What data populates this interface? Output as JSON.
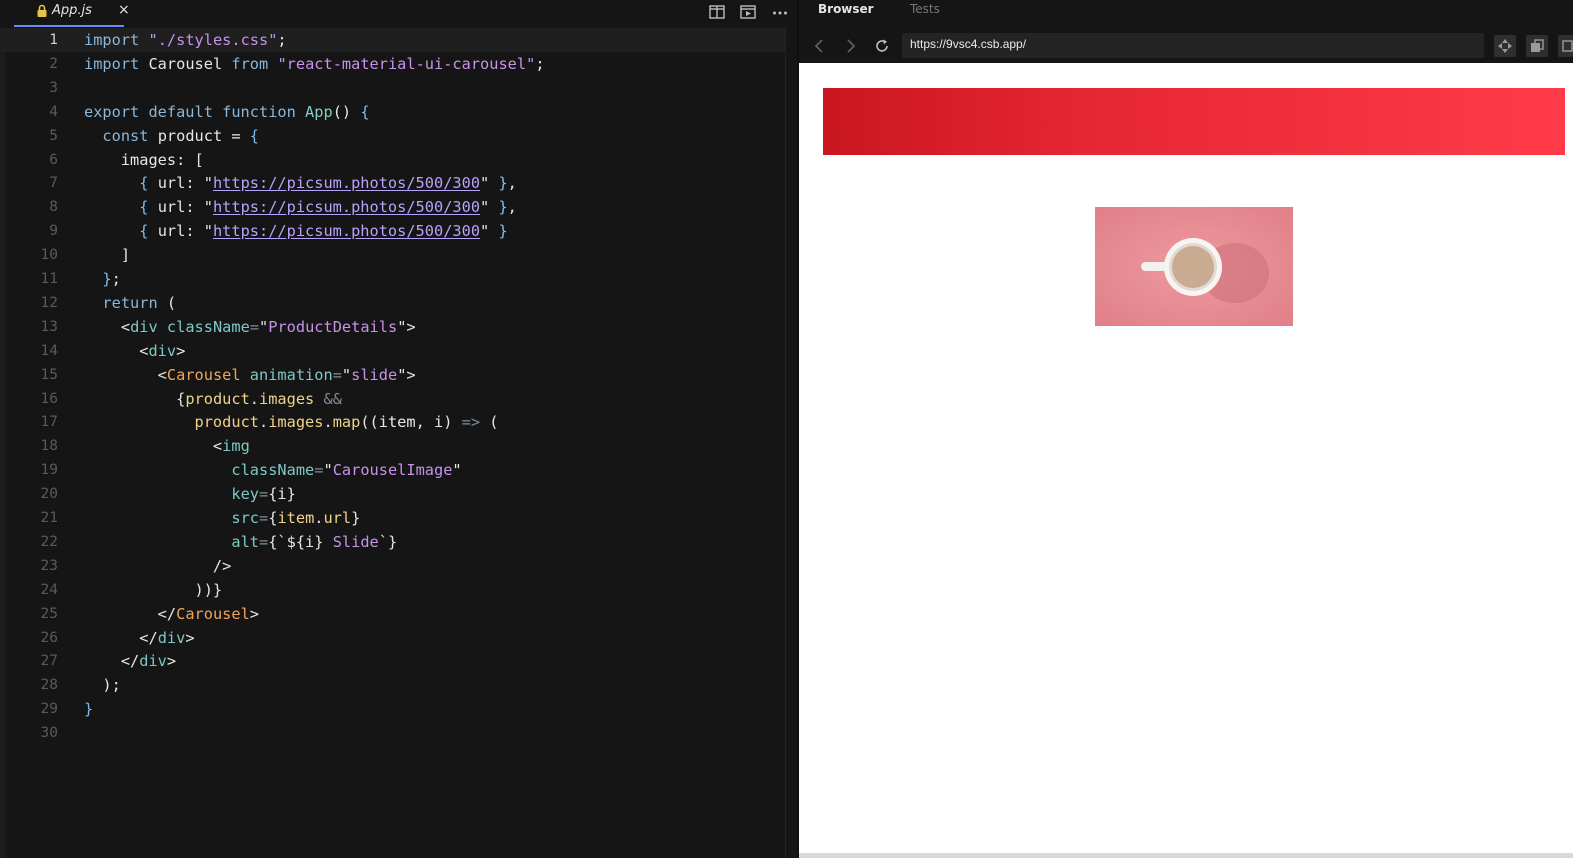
{
  "editor": {
    "tab": {
      "title": "App.js",
      "close": "×"
    },
    "toolbar_icons": [
      "split-editor-icon",
      "preview-icon",
      "more-icon"
    ],
    "lines": [
      {
        "n": "1",
        "tokens": [
          [
            "kw",
            "import"
          ],
          [
            "ident",
            " "
          ],
          [
            "str",
            "\"./styles.css\""
          ],
          [
            "ident",
            ";"
          ]
        ]
      },
      {
        "n": "2",
        "tokens": [
          [
            "kw",
            "import"
          ],
          [
            "ident",
            " Carousel "
          ],
          [
            "kw",
            "from"
          ],
          [
            "ident",
            " "
          ],
          [
            "str",
            "\"react-material-ui-carousel\""
          ],
          [
            "ident",
            ";"
          ]
        ]
      },
      {
        "n": "3",
        "tokens": []
      },
      {
        "n": "4",
        "tokens": [
          [
            "kw",
            "export default function"
          ],
          [
            "ident",
            " "
          ],
          [
            "fn",
            "App"
          ],
          [
            "ident",
            "() "
          ],
          [
            "brace",
            "{"
          ]
        ]
      },
      {
        "n": "5",
        "tokens": [
          [
            "ident",
            "  "
          ],
          [
            "kw",
            "const"
          ],
          [
            "ident",
            " product = "
          ],
          [
            "brace",
            "{"
          ]
        ]
      },
      {
        "n": "6",
        "tokens": [
          [
            "ident",
            "    images: ["
          ]
        ]
      },
      {
        "n": "7",
        "tokens": [
          [
            "ident",
            "      "
          ],
          [
            "brace",
            "{"
          ],
          [
            "ident",
            " url: \""
          ],
          [
            "link",
            "https://picsum.photos/500/300"
          ],
          [
            "ident",
            "\" "
          ],
          [
            "brace",
            "}"
          ],
          [
            "ident",
            ","
          ]
        ]
      },
      {
        "n": "8",
        "tokens": [
          [
            "ident",
            "      "
          ],
          [
            "brace",
            "{"
          ],
          [
            "ident",
            " url: \""
          ],
          [
            "link",
            "https://picsum.photos/500/300"
          ],
          [
            "ident",
            "\" "
          ],
          [
            "brace",
            "}"
          ],
          [
            "ident",
            ","
          ]
        ]
      },
      {
        "n": "9",
        "tokens": [
          [
            "ident",
            "      "
          ],
          [
            "brace",
            "{"
          ],
          [
            "ident",
            " url: \""
          ],
          [
            "link",
            "https://picsum.photos/500/300"
          ],
          [
            "ident",
            "\" "
          ],
          [
            "brace",
            "}"
          ]
        ]
      },
      {
        "n": "10",
        "tokens": [
          [
            "ident",
            "    ]"
          ]
        ]
      },
      {
        "n": "11",
        "tokens": [
          [
            "ident",
            "  "
          ],
          [
            "brace",
            "}"
          ],
          [
            "ident",
            ";"
          ]
        ]
      },
      {
        "n": "12",
        "tokens": [
          [
            "ident",
            "  "
          ],
          [
            "kw",
            "return"
          ],
          [
            "ident",
            " ("
          ]
        ]
      },
      {
        "n": "13",
        "tokens": [
          [
            "ident",
            "    <"
          ],
          [
            "tagname",
            "div"
          ],
          [
            "ident",
            " "
          ],
          [
            "attr",
            "className"
          ],
          [
            "op",
            "="
          ],
          [
            "ident",
            "\""
          ],
          [
            "str",
            "ProductDetails"
          ],
          [
            "ident",
            "\">"
          ]
        ]
      },
      {
        "n": "14",
        "tokens": [
          [
            "ident",
            "      <"
          ],
          [
            "tagname",
            "div"
          ],
          [
            "ident",
            ">"
          ]
        ]
      },
      {
        "n": "15",
        "tokens": [
          [
            "ident",
            "        <"
          ],
          [
            "tag",
            "Carousel"
          ],
          [
            "ident",
            " "
          ],
          [
            "attr",
            "animation"
          ],
          [
            "op",
            "="
          ],
          [
            "ident",
            "\""
          ],
          [
            "str",
            "slide"
          ],
          [
            "ident",
            "\">"
          ]
        ]
      },
      {
        "n": "16",
        "tokens": [
          [
            "ident",
            "          {"
          ],
          [
            "prop",
            "product"
          ],
          [
            "ident",
            "."
          ],
          [
            "prop",
            "images"
          ],
          [
            "ident",
            " "
          ],
          [
            "op",
            "&&"
          ]
        ]
      },
      {
        "n": "17",
        "tokens": [
          [
            "ident",
            "            "
          ],
          [
            "prop",
            "product"
          ],
          [
            "ident",
            "."
          ],
          [
            "prop",
            "images"
          ],
          [
            "ident",
            "."
          ],
          [
            "prop",
            "map"
          ],
          [
            "ident",
            "((item, i) "
          ],
          [
            "op",
            "=>"
          ],
          [
            "ident",
            " ("
          ]
        ]
      },
      {
        "n": "18",
        "tokens": [
          [
            "ident",
            "              <"
          ],
          [
            "tagname",
            "img"
          ]
        ]
      },
      {
        "n": "19",
        "tokens": [
          [
            "ident",
            "                "
          ],
          [
            "attr",
            "className"
          ],
          [
            "op",
            "="
          ],
          [
            "ident",
            "\""
          ],
          [
            "str",
            "CarouselImage"
          ],
          [
            "ident",
            "\""
          ]
        ]
      },
      {
        "n": "20",
        "tokens": [
          [
            "ident",
            "                "
          ],
          [
            "attr",
            "key"
          ],
          [
            "op",
            "="
          ],
          [
            "ident",
            "{i}"
          ]
        ]
      },
      {
        "n": "21",
        "tokens": [
          [
            "ident",
            "                "
          ],
          [
            "attr",
            "src"
          ],
          [
            "op",
            "="
          ],
          [
            "ident",
            "{"
          ],
          [
            "prop",
            "item"
          ],
          [
            "ident",
            "."
          ],
          [
            "prop",
            "url"
          ],
          [
            "ident",
            "}"
          ]
        ]
      },
      {
        "n": "22",
        "tokens": [
          [
            "ident",
            "                "
          ],
          [
            "attr",
            "alt"
          ],
          [
            "op",
            "="
          ],
          [
            "ident",
            "{`${i} "
          ],
          [
            "str",
            "Slide"
          ],
          [
            "ident",
            "`}"
          ]
        ]
      },
      {
        "n": "23",
        "tokens": [
          [
            "ident",
            "              />"
          ]
        ]
      },
      {
        "n": "24",
        "tokens": [
          [
            "ident",
            "            ))}"
          ]
        ]
      },
      {
        "n": "25",
        "tokens": [
          [
            "ident",
            "        </"
          ],
          [
            "tag",
            "Carousel"
          ],
          [
            "ident",
            ">"
          ]
        ]
      },
      {
        "n": "26",
        "tokens": [
          [
            "ident",
            "      </"
          ],
          [
            "tagname",
            "div"
          ],
          [
            "ident",
            ">"
          ]
        ]
      },
      {
        "n": "27",
        "tokens": [
          [
            "ident",
            "    </"
          ],
          [
            "tagname",
            "div"
          ],
          [
            "ident",
            ">"
          ]
        ]
      },
      {
        "n": "28",
        "tokens": [
          [
            "ident",
            "  );"
          ]
        ]
      },
      {
        "n": "29",
        "tokens": [
          [
            "brace",
            "}"
          ]
        ]
      },
      {
        "n": "30",
        "tokens": []
      }
    ],
    "active_line": "1"
  },
  "browser": {
    "tabs": {
      "browser": "Browser",
      "tests": "Tests"
    },
    "url": "https://9vsc4.csb.app/",
    "colors": {
      "banner_start": "#c9161f",
      "banner_end": "#ff3b48",
      "photo_bg": "#e88b92"
    }
  }
}
